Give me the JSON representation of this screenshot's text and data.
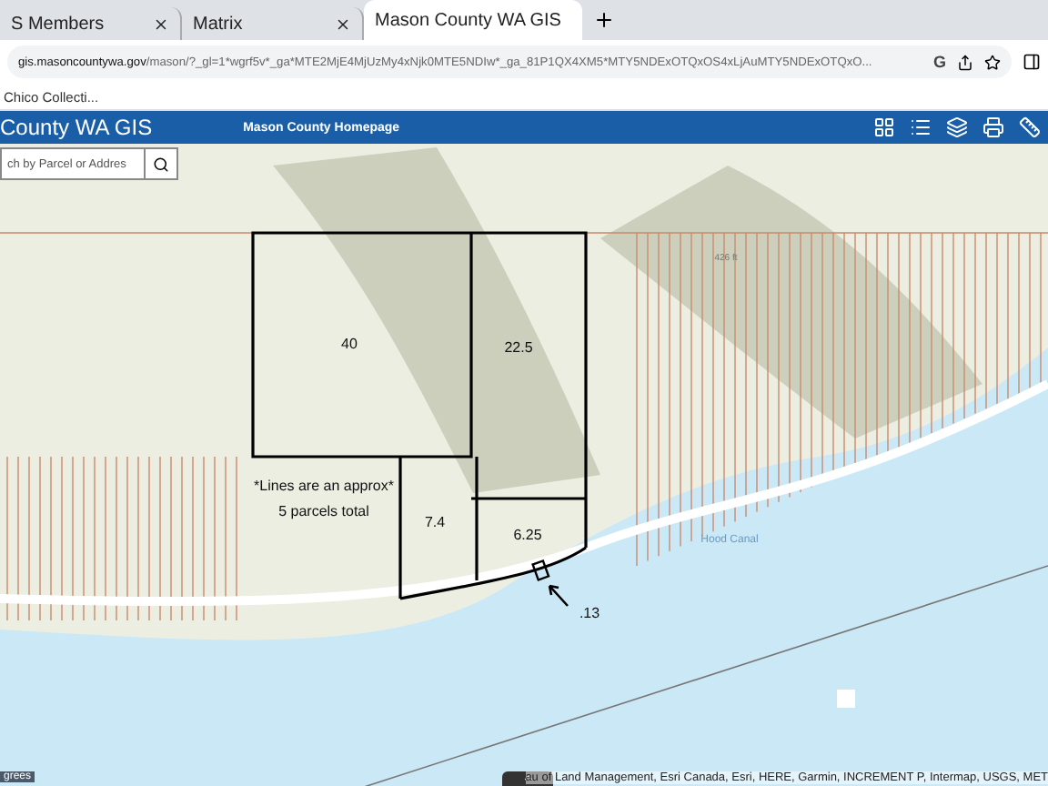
{
  "browser": {
    "tabs": [
      {
        "title": "S Members",
        "selected": false
      },
      {
        "title": "Matrix",
        "selected": false
      },
      {
        "title": "Mason County WA GIS",
        "selected": true
      }
    ],
    "url": {
      "lens": "G",
      "host": "gis.masoncountywa.gov",
      "path": "/mason/?_gl=1*wgrf5v*_ga*MTE2MjE4MjUzMy4xNjk0MTE5NDIw*_ga_81P1QX4XM5*MTY5NDExOTQxOS4xLjAuMTY5NDExOTQxO..."
    },
    "bookmarks": [
      "Chico Collecti..."
    ]
  },
  "app": {
    "title": "County WA GIS",
    "nav_link": "Mason County Homepage",
    "search": {
      "placeholder": "ch by Parcel or Addres"
    }
  },
  "map": {
    "parcels": [
      {
        "label": "40"
      },
      {
        "label": "22.5"
      },
      {
        "label": "7.4"
      },
      {
        "label": "6.25"
      }
    ],
    "note": [
      "*Lines are an approx*",
      "5 parcels total"
    ],
    "pointer_label": ".13",
    "elevation_label": "426 ft",
    "water_label": "Hood Canal",
    "scale_badge": "grees",
    "attribution": "au of Land Management, Esri Canada, Esri, HERE, Garmin, INCREMENT P, Intermap, USGS, MET"
  }
}
